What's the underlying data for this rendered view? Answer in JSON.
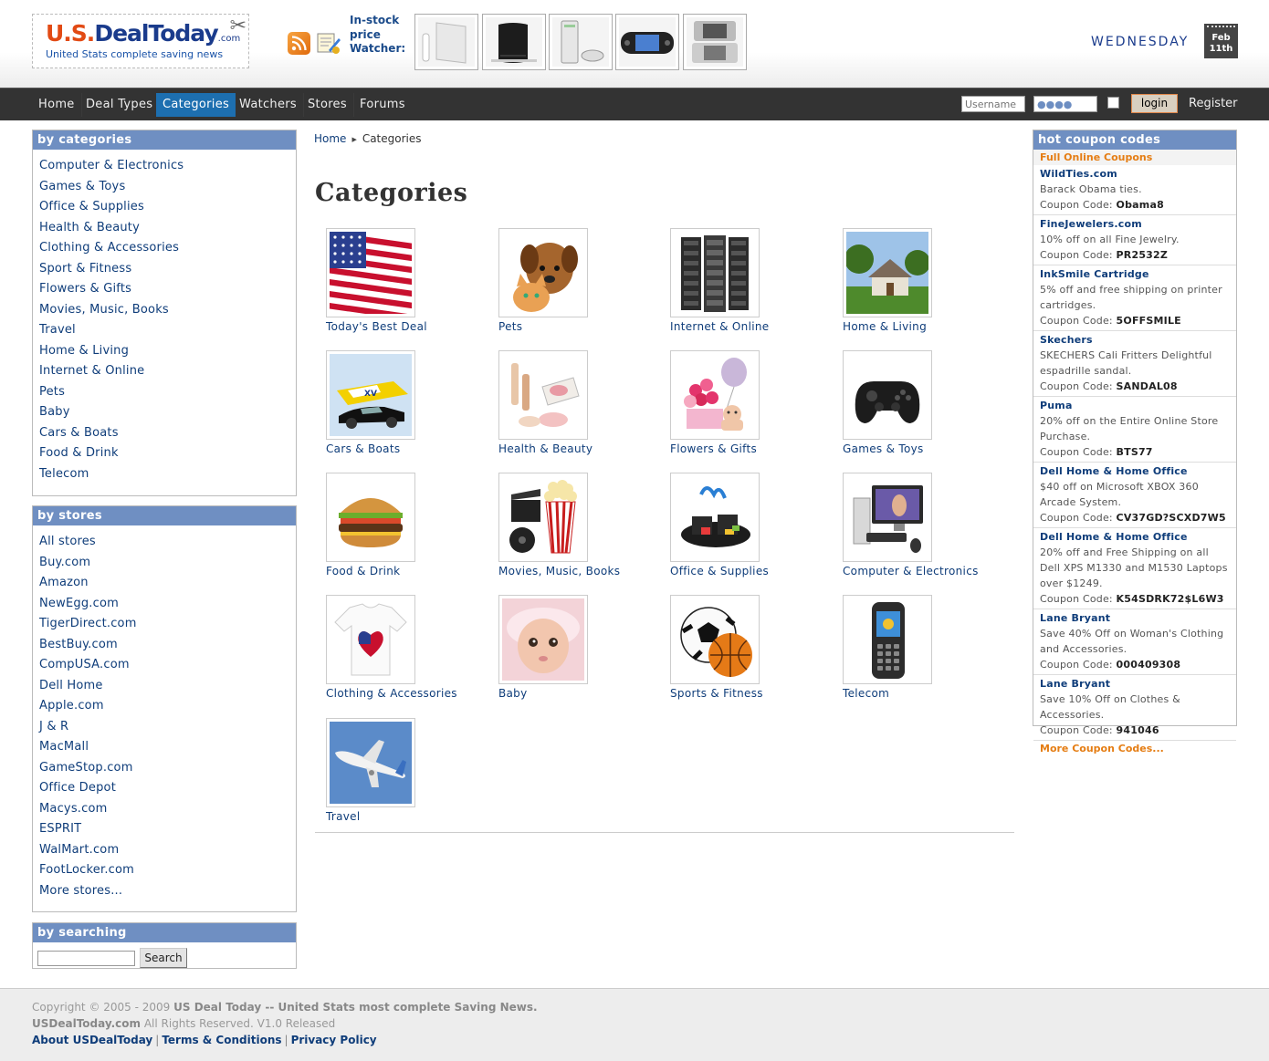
{
  "header": {
    "logo_us": "U.S.",
    "logo_dealtoday": "DealToday",
    "logo_com": ".com",
    "logo_tagline": "United Stats complete saving news",
    "watcher_label": "In-stock price Watcher:",
    "day": "WEDNESDAY",
    "cal_month": "Feb",
    "cal_day": "11th"
  },
  "nav": {
    "items": [
      "Home",
      "Deal Types",
      "Categories",
      "Watchers",
      "Stores",
      "Forums"
    ],
    "active": "Categories",
    "username_placeholder": "Username",
    "password_value": "●●●●",
    "login_label": "login",
    "register_label": "Register"
  },
  "sidebar": {
    "categories_title": "by categories",
    "categories": [
      "Computer & Electronics",
      "Games & Toys",
      "Office & Supplies",
      "Health & Beauty",
      "Clothing & Accessories",
      "Sport & Fitness",
      "Flowers & Gifts",
      "Movies, Music, Books",
      "Travel",
      "Home & Living",
      "Internet & Online",
      "Pets",
      "Baby",
      "Cars & Boats",
      "Food & Drink",
      "Telecom"
    ],
    "stores_title": "by stores",
    "stores": [
      "All stores",
      "Buy.com",
      "Amazon",
      "NewEgg.com",
      "TigerDirect.com",
      "BestBuy.com",
      "CompUSA.com",
      "Dell Home",
      "Apple.com",
      "J & R",
      "MacMall",
      "GameStop.com",
      "Office Depot",
      "Macys.com",
      "ESPRIT",
      "WalMart.com",
      "FootLocker.com",
      "More stores..."
    ],
    "search_title": "by searching",
    "search_button": "Search"
  },
  "main": {
    "breadcrumb_home": "Home",
    "breadcrumb_current": "Categories",
    "title": "Categories",
    "categories": [
      {
        "label": "Today's Best Deal",
        "icon": "us-flag-icon"
      },
      {
        "label": "Pets",
        "icon": "puppy-kitten-icon"
      },
      {
        "label": "Internet & Online",
        "icon": "server-rack-icon"
      },
      {
        "label": "Home & Living",
        "icon": "house-icon"
      },
      {
        "label": "Cars & Boats",
        "icon": "boat-car-icon"
      },
      {
        "label": "Health & Beauty",
        "icon": "cosmetics-icon"
      },
      {
        "label": "Flowers & Gifts",
        "icon": "flowers-gift-icon"
      },
      {
        "label": "Games & Toys",
        "icon": "gamepad-icon"
      },
      {
        "label": "Food & Drink",
        "icon": "burger-icon"
      },
      {
        "label": "Movies, Music, Books",
        "icon": "popcorn-film-icon"
      },
      {
        "label": "Office & Supplies",
        "icon": "desk-organizer-icon"
      },
      {
        "label": "Computer & Electronics",
        "icon": "computer-icon"
      },
      {
        "label": "Clothing & Accessories",
        "icon": "tshirt-icon"
      },
      {
        "label": "Baby",
        "icon": "baby-icon"
      },
      {
        "label": "Sports & Fitness",
        "icon": "balls-icon"
      },
      {
        "label": "Telecom",
        "icon": "cellphone-icon"
      },
      {
        "label": "Travel",
        "icon": "airplane-icon"
      }
    ]
  },
  "coupons": {
    "title": "hot coupon codes",
    "subtitle": "Full Online Coupons",
    "code_label": "Coupon Code:",
    "items": [
      {
        "store": "WildTies.com",
        "desc": "Barack Obama ties.",
        "code": "Obama8"
      },
      {
        "store": "FineJewelers.com",
        "desc": "10% off on all Fine Jewelry.",
        "code": "PR2532Z"
      },
      {
        "store": "InkSmile Cartridge",
        "desc": "5% off and free shipping on printer cartridges.",
        "code": "5OFFSMILE"
      },
      {
        "store": "Skechers",
        "desc": "SKECHERS Cali Fritters Delightful espadrille sandal.",
        "code": "SANDAL08"
      },
      {
        "store": "Puma",
        "desc": "20% off on the Entire Online Store Purchase.",
        "code": "BTS77"
      },
      {
        "store": "Dell Home & Home Office",
        "desc": "$40 off on Microsoft XBOX 360 Arcade System.",
        "code": "CV37GD?SCXD7W5"
      },
      {
        "store": "Dell Home & Home Office",
        "desc": "20% off and Free Shipping on all Dell XPS M1330 and M1530 Laptops over $1249.",
        "code": "K54SDRK72$L6W3"
      },
      {
        "store": "Lane Bryant",
        "desc": "Save 40% Off on Woman's Clothing and Accessories.",
        "code": "000409308"
      },
      {
        "store": "Lane Bryant",
        "desc": "Save 10% Off on Clothes & Accessories.",
        "code": "941046"
      }
    ],
    "more": "More Coupon Codes..."
  },
  "footer": {
    "copyright_prefix": "Copyright © 2005 - 2009",
    "copyright_site": "US Deal Today -- United Stats most complete Saving News.",
    "domain": "USDealToday.com",
    "rights": "All Rights Reserved. V1.0 Released",
    "links": [
      "About USDealToday",
      "Terms & Conditions",
      "Privacy Policy"
    ]
  },
  "colors": {
    "accent_blue": "#1d6fb0",
    "box_header": "#6f8fc2",
    "link": "#0f3d7a",
    "orange": "#e57d13"
  }
}
